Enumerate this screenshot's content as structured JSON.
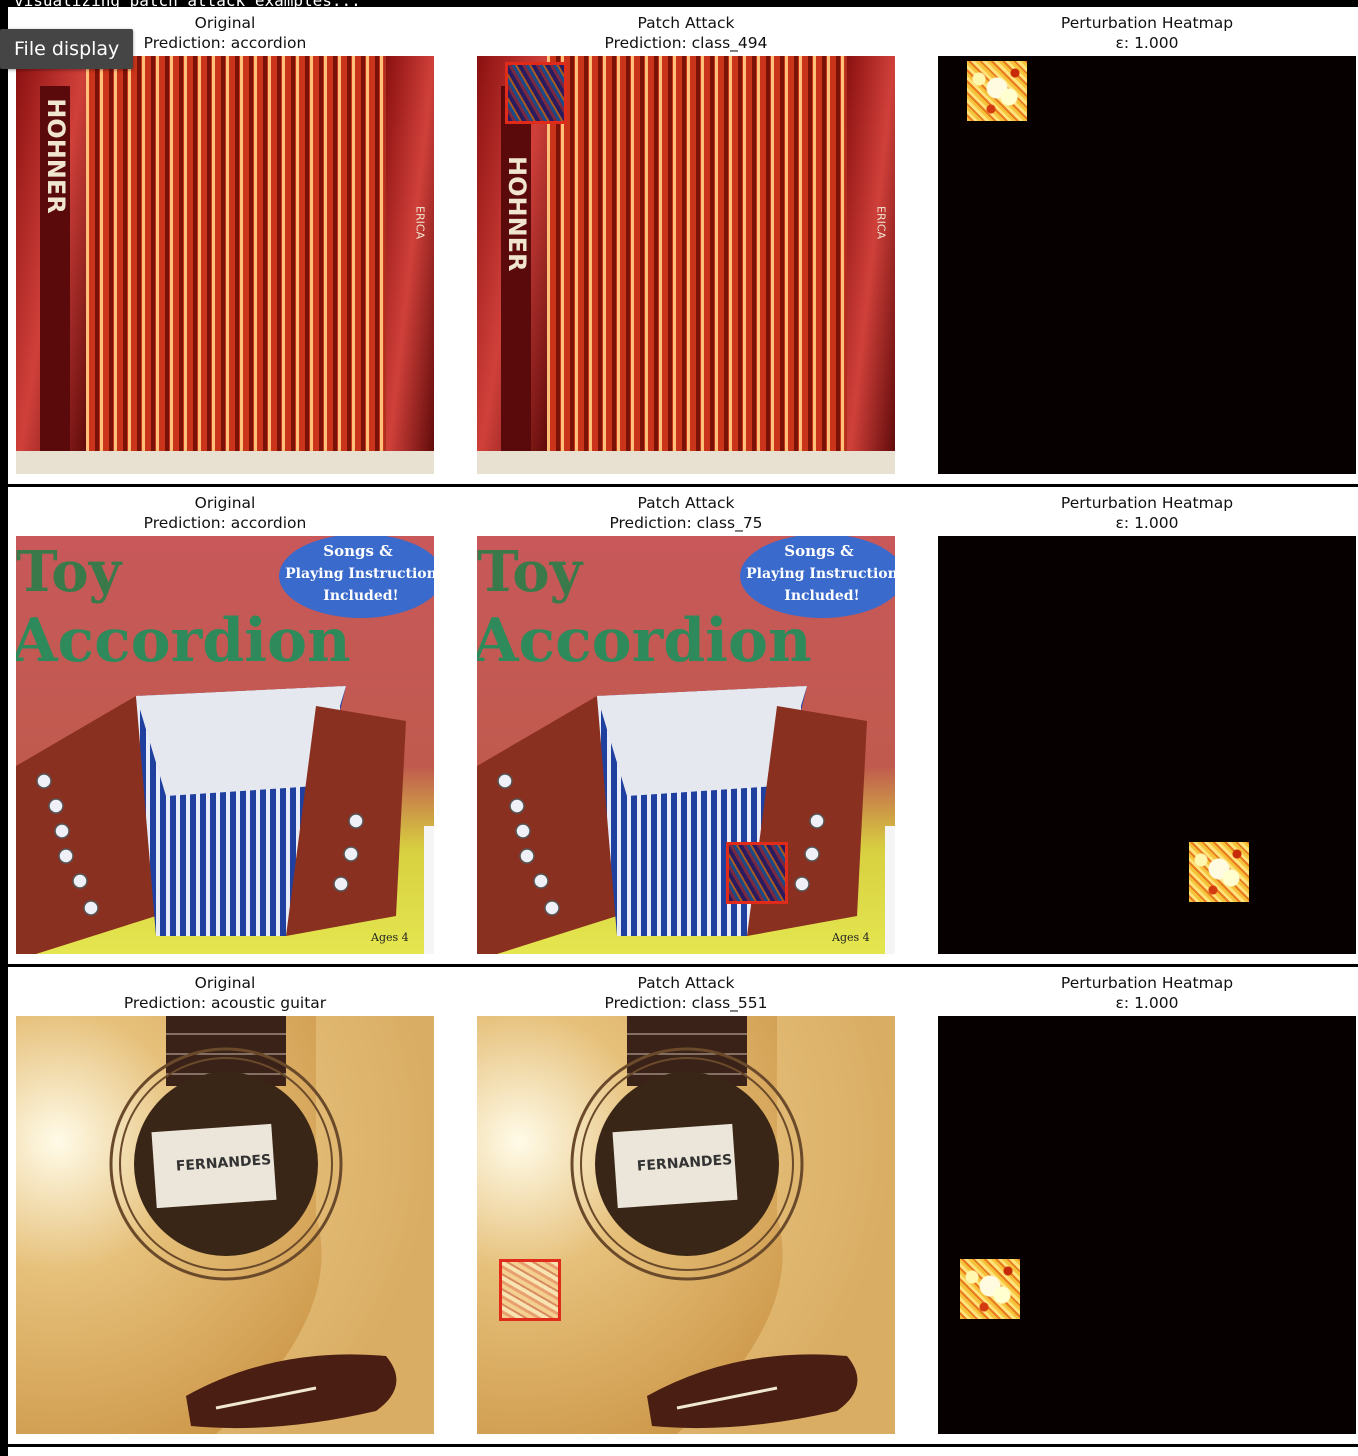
{
  "top_partial_text": "visualizing patch attack examples...",
  "tooltip": "File display",
  "colors": {
    "patch_border": "#e02a1a",
    "heatmap_bg": "#070000"
  },
  "rows": [
    {
      "original": {
        "title": "Original",
        "prediction": "Prediction: accordion",
        "image": "accordion-bellows-hohner"
      },
      "attack": {
        "title": "Patch Attack",
        "prediction": "Prediction: class_494"
      },
      "heatmap": {
        "title": "Perturbation Heatmap",
        "epsilon": "ε: 1.000"
      }
    },
    {
      "original": {
        "title": "Original",
        "prediction": "Prediction: accordion",
        "image": "toy-accordion-cover"
      },
      "attack": {
        "title": "Patch Attack",
        "prediction": "Prediction: class_75"
      },
      "heatmap": {
        "title": "Perturbation Heatmap",
        "epsilon": "ε: 1.000"
      }
    },
    {
      "original": {
        "title": "Original",
        "prediction": "Prediction: acoustic guitar",
        "image": "acoustic-guitar-soundhole"
      },
      "attack": {
        "title": "Patch Attack",
        "prediction": "Prediction: class_551"
      },
      "heatmap": {
        "title": "Perturbation Heatmap",
        "epsilon": "ε: 1.000"
      }
    }
  ],
  "image_text": {
    "brand": "HOHNER",
    "model": "ERICA",
    "cover_line1": "Toy",
    "cover_line2": "Accordion",
    "badge1": "Songs &",
    "badge2": "Playing Instruction",
    "badge3": "Included!",
    "age": "Ages 4",
    "label": "FERNANDES"
  }
}
